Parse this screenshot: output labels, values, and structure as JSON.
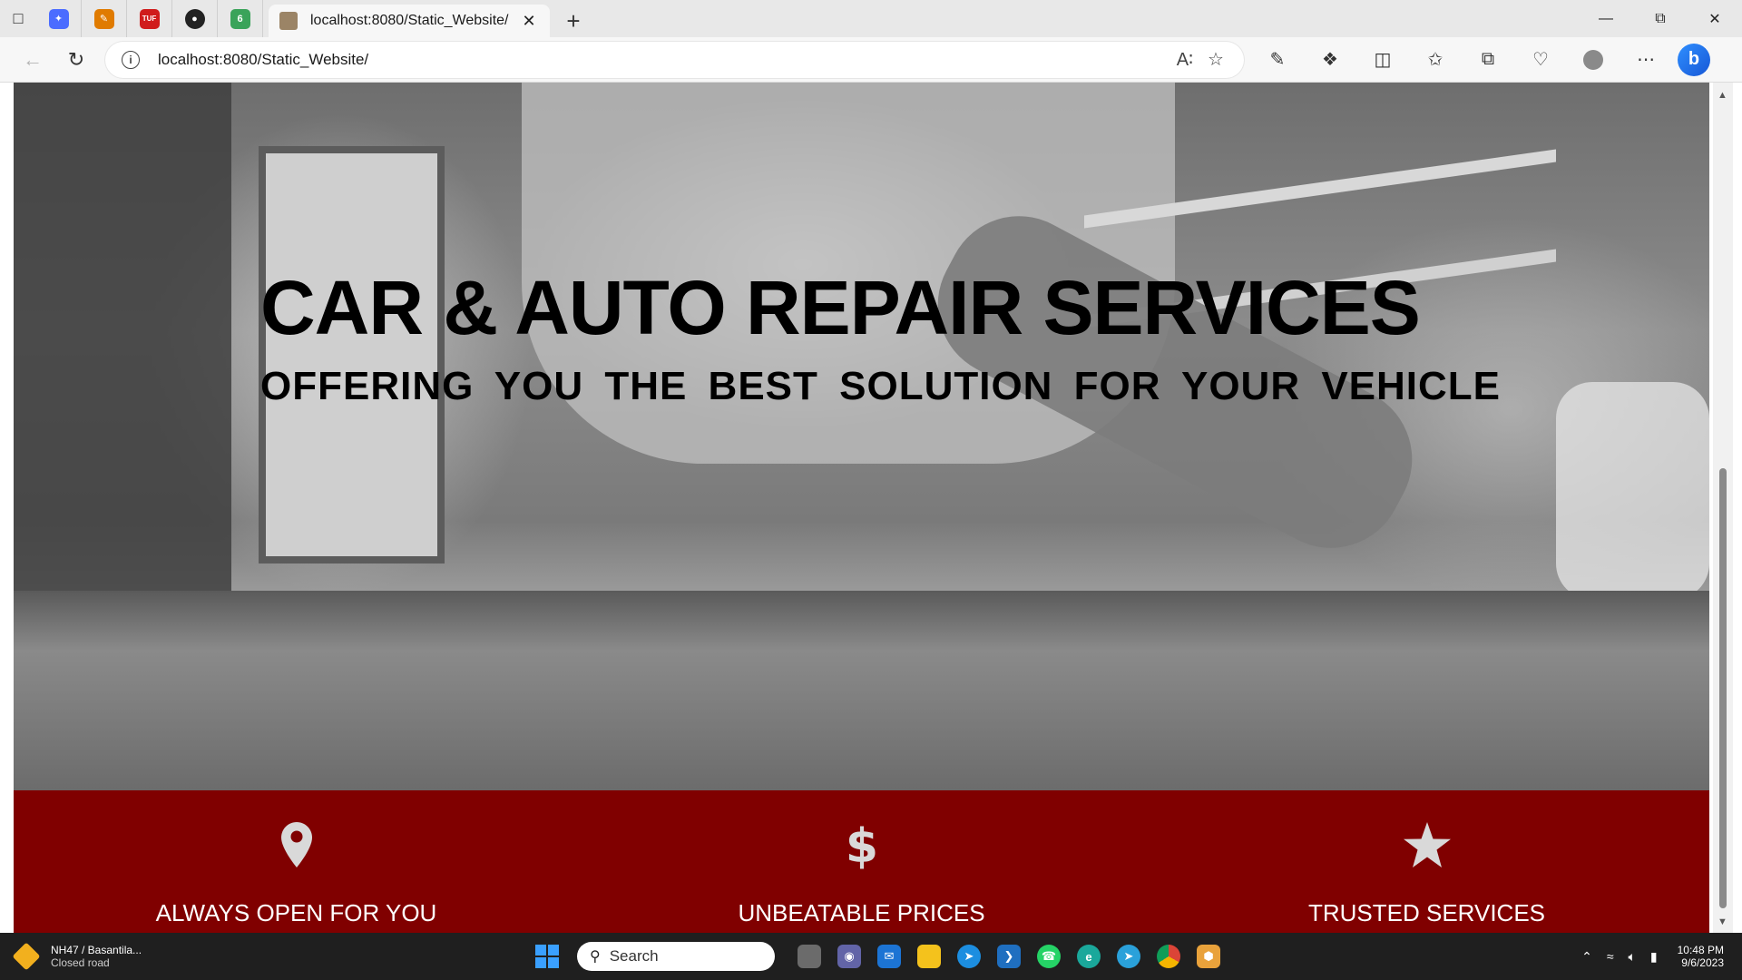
{
  "browser": {
    "pinned_tabs": [
      {
        "name": "pinned-tab-1",
        "icon": "feather-icon",
        "color": "#4b6cff",
        "glyph": "⚙"
      },
      {
        "name": "pinned-tab-2",
        "icon": "brush-icon",
        "color": "#e07b00",
        "glyph": "✒"
      },
      {
        "name": "pinned-tab-3",
        "icon": "tuf-icon",
        "color": "#d01c1c",
        "glyph": "TUF"
      },
      {
        "name": "pinned-tab-4",
        "icon": "github-icon",
        "color": "#222222",
        "glyph": "●"
      },
      {
        "name": "pinned-tab-5",
        "icon": "leaf-icon",
        "color": "#3aa35a",
        "glyph": "6"
      }
    ],
    "active_tab_title": "localhost:8080/Static_Website/",
    "url": "localhost:8080/Static_Website/"
  },
  "hero": {
    "title": "CAR & AUTO REPAIR SERVICES",
    "subtitle": "OFFERING YOU THE BEST SOLUTION FOR YOUR VEHICLE"
  },
  "features": [
    {
      "icon": "location-pin-icon",
      "label": "ALWAYS OPEN FOR YOU"
    },
    {
      "icon": "dollar-icon",
      "label": "UNBEATABLE PRICES"
    },
    {
      "icon": "star-icon",
      "label": "TRUSTED SERVICES"
    }
  ],
  "taskbar": {
    "weather_line1": "NH47 / Basantila...",
    "weather_line2": "Closed road",
    "search_placeholder": "Search",
    "time": "10:48 PM",
    "date": "9/6/2023"
  },
  "colors": {
    "feature_band": "#800000",
    "taskbar": "#1f1f1f"
  }
}
